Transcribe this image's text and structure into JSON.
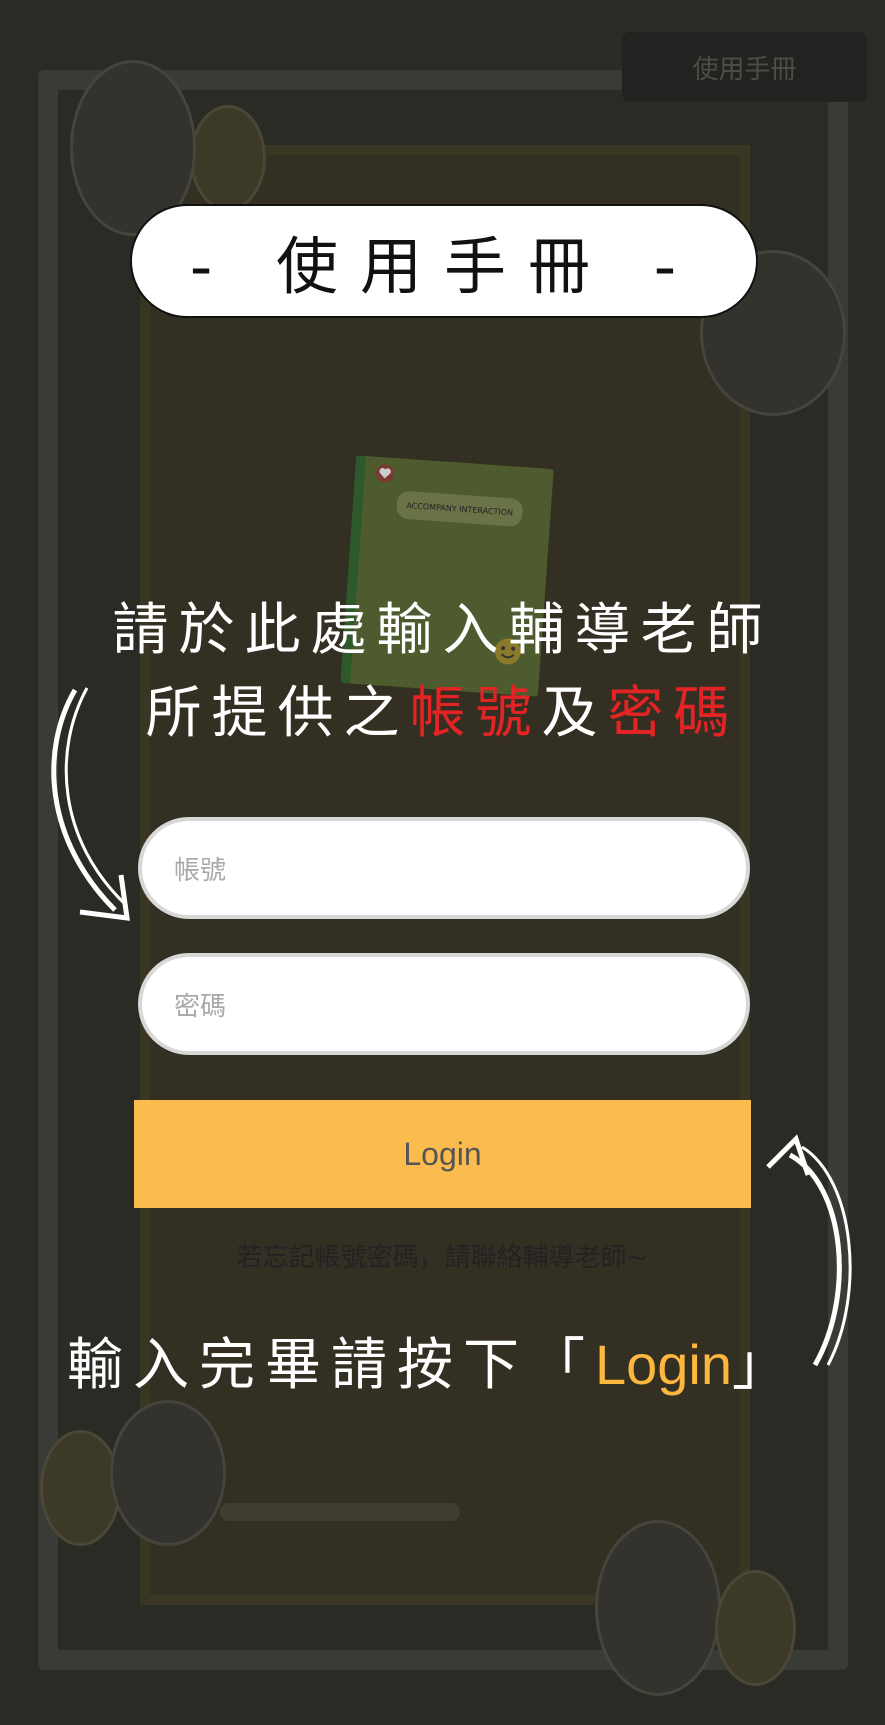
{
  "header": {
    "manual_button_label": "使用手冊"
  },
  "overlay": {
    "title": "- 使用手冊 -",
    "book_title": "ACCOMPANY INTERACTION",
    "instruction_line1": "請於此處輸入輔導老師",
    "instruction_line2_prefix": "所提供之",
    "instruction_account": "帳號",
    "instruction_and": "及",
    "instruction_password": "密碼",
    "bottom_prefix": "輸入完畢請按下「",
    "bottom_login": "Login",
    "bottom_suffix": "」"
  },
  "form": {
    "account_placeholder": "帳號",
    "password_placeholder": "密碼",
    "login_label": "Login",
    "forgot_text": "若忘記帳號密碼，請聯絡輔導老師~"
  },
  "colors": {
    "accent": "#fbbc4d",
    "highlight_red": "#e42424",
    "overlay": "#2b2b25"
  }
}
